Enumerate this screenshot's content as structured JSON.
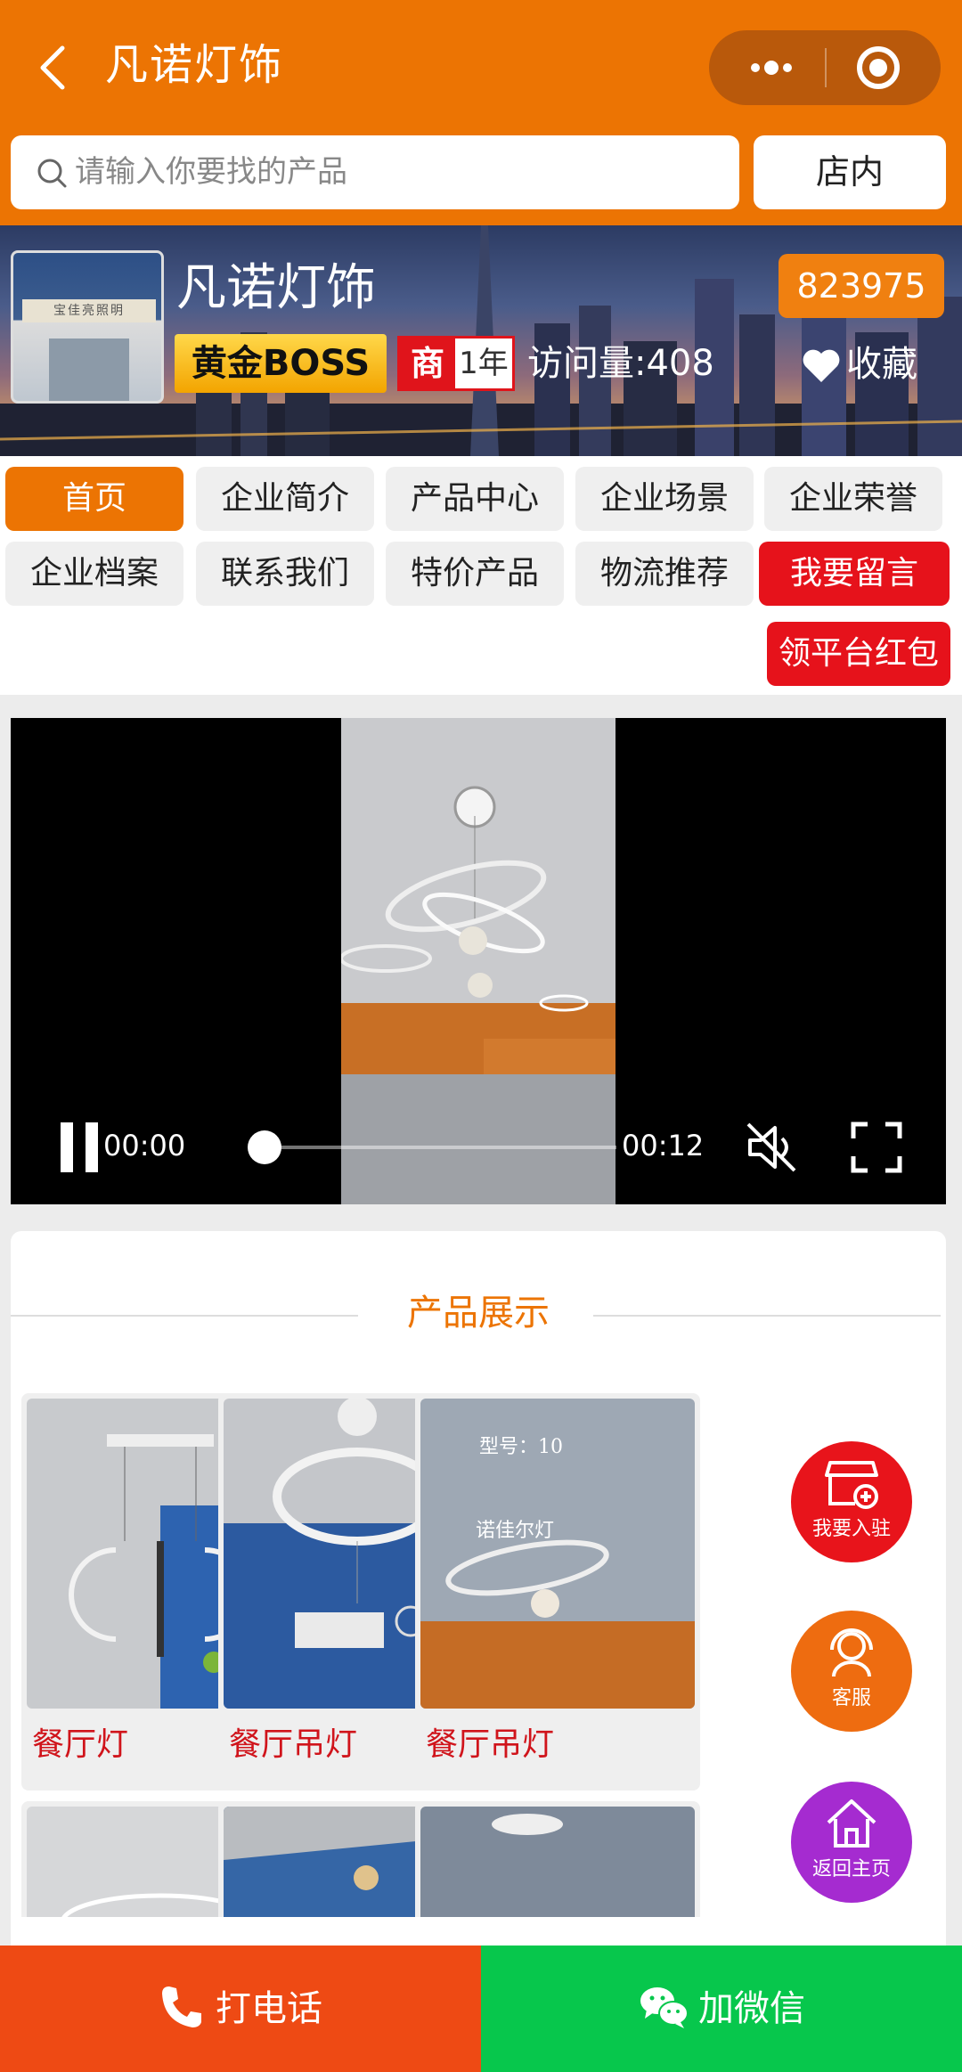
{
  "header": {
    "title": "凡诺灯饰"
  },
  "search": {
    "placeholder": "请输入你要找的产品",
    "store_label": "店内"
  },
  "shop": {
    "name": "凡诺灯饰",
    "level_badge": "黄金BOSS",
    "merchant_badge": "商",
    "years": "1年",
    "visits": "访问量:408",
    "code": "823975",
    "favorite_label": "收藏",
    "logo_sign": "宝佳亮照明"
  },
  "nav": {
    "items": [
      "首页",
      "企业简介",
      "产品中心",
      "企业场景",
      "企业荣誉",
      "企业档案",
      "联系我们",
      "特价产品",
      "物流推荐",
      "我要留言"
    ],
    "extra": "领平台红包"
  },
  "video": {
    "current_time": "00:00",
    "duration": "00:12",
    "progress": 0
  },
  "products": {
    "title": "产品展示",
    "items": [
      {
        "label": "餐厅灯"
      },
      {
        "label": "餐厅吊灯"
      },
      {
        "label": "餐厅吊灯"
      }
    ],
    "watermark": [
      "型号：10",
      "诺佳尔灯"
    ]
  },
  "floating": {
    "join": "我要入驻",
    "service": "客服",
    "home": "返回主页"
  },
  "bottom": {
    "call": "打电话",
    "wechat": "加微信"
  },
  "colors": {
    "primary": "#ec7403",
    "red": "#e6121b",
    "green": "#07c74c",
    "call": "#ee4a14",
    "purple": "#a52bd0"
  }
}
